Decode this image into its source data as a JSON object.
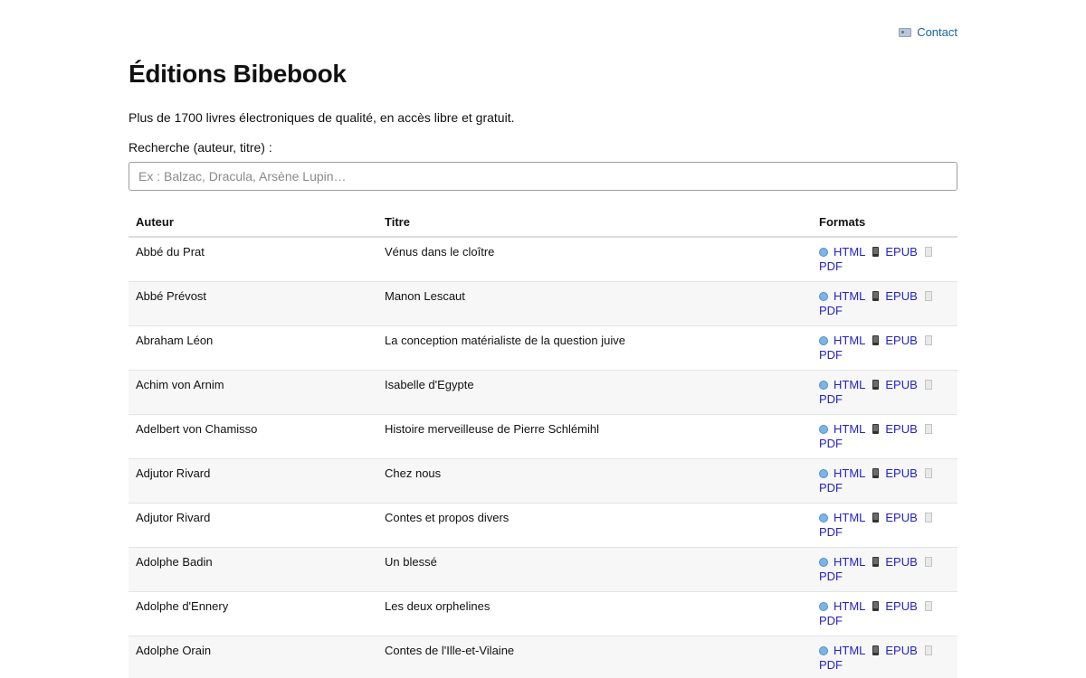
{
  "header": {
    "contact_label": "Contact",
    "contact_icon": "id-card-icon"
  },
  "title": "Éditions Bibebook",
  "intro": "Plus de 1700 livres électroniques de qualité, en accès libre et gratuit.",
  "search": {
    "label": "Recherche (auteur, titre) :",
    "placeholder": "Ex : Balzac, Dracula, Arsène Lupin…",
    "value": ""
  },
  "table": {
    "columns": [
      "Auteur",
      "Titre",
      "Formats"
    ],
    "format_labels": {
      "html": "HTML",
      "epub": "EPUB",
      "pdf": "PDF"
    },
    "rows": [
      {
        "author": "Abbé du Prat",
        "title": "Vénus dans le cloître"
      },
      {
        "author": "Abbé Prévost",
        "title": "Manon Lescaut"
      },
      {
        "author": "Abraham Léon",
        "title": "La conception matérialiste de la question juive"
      },
      {
        "author": "Achim von Arnim",
        "title": "Isabelle d'Egypte"
      },
      {
        "author": "Adelbert von Chamisso",
        "title": "Histoire merveilleuse de Pierre Schlémihl"
      },
      {
        "author": "Adjutor Rivard",
        "title": "Chez nous"
      },
      {
        "author": "Adjutor Rivard",
        "title": "Contes et propos divers"
      },
      {
        "author": "Adolphe Badin",
        "title": "Un blessé"
      },
      {
        "author": "Adolphe d'Ennery",
        "title": "Les deux orphelines"
      },
      {
        "author": "Adolphe Orain",
        "title": "Contes de l'Ille-et-Vilaine"
      }
    ]
  },
  "colors": {
    "link": "#2323c8",
    "contact_link": "#1565a8",
    "row_alt": "#f7f7f7"
  }
}
